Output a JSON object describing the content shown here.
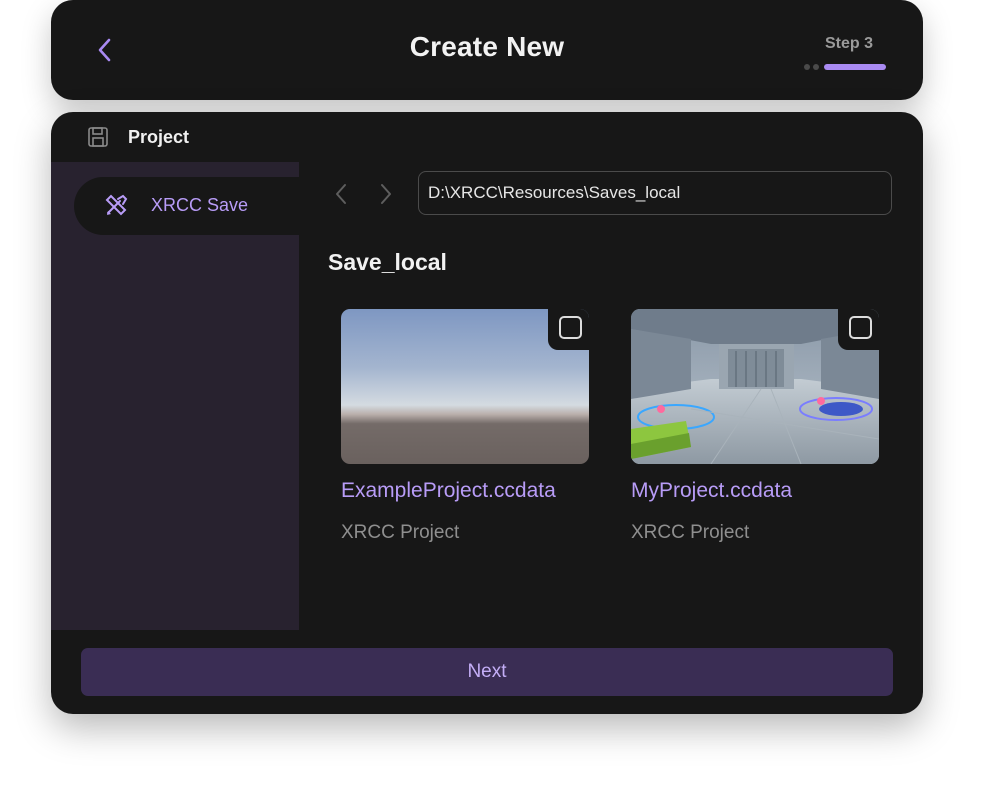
{
  "header": {
    "title": "Create New",
    "step_label": "Step 3",
    "back_icon": "chevron-left-icon",
    "progress": {
      "current_step": 3,
      "total_steps": 3
    }
  },
  "panel": {
    "title": "Project",
    "title_icon": "save-icon"
  },
  "sidebar": {
    "items": [
      {
        "label": "XRCC Save",
        "icon": "tools-icon",
        "selected": true
      }
    ]
  },
  "browser": {
    "path": "D:\\XRCC\\Resources\\Saves_local",
    "folder_title": "Save_local",
    "back_icon": "chevron-left-icon",
    "forward_icon": "chevron-right-icon"
  },
  "files": [
    {
      "name": "ExampleProject.ccdata",
      "type": "XRCC Project",
      "thumbnail": "sky-horizon-scene",
      "checked": false
    },
    {
      "name": "MyProject.ccdata",
      "type": "XRCC Project",
      "thumbnail": "space-station-interior",
      "checked": false
    }
  ],
  "footer": {
    "next_label": "Next"
  },
  "colors": {
    "accent": "#a98af2",
    "accent_text": "#b89cf7",
    "panel_bg": "#171717",
    "sidebar_bg": "#28222f",
    "button_bg": "#3a2d54"
  }
}
